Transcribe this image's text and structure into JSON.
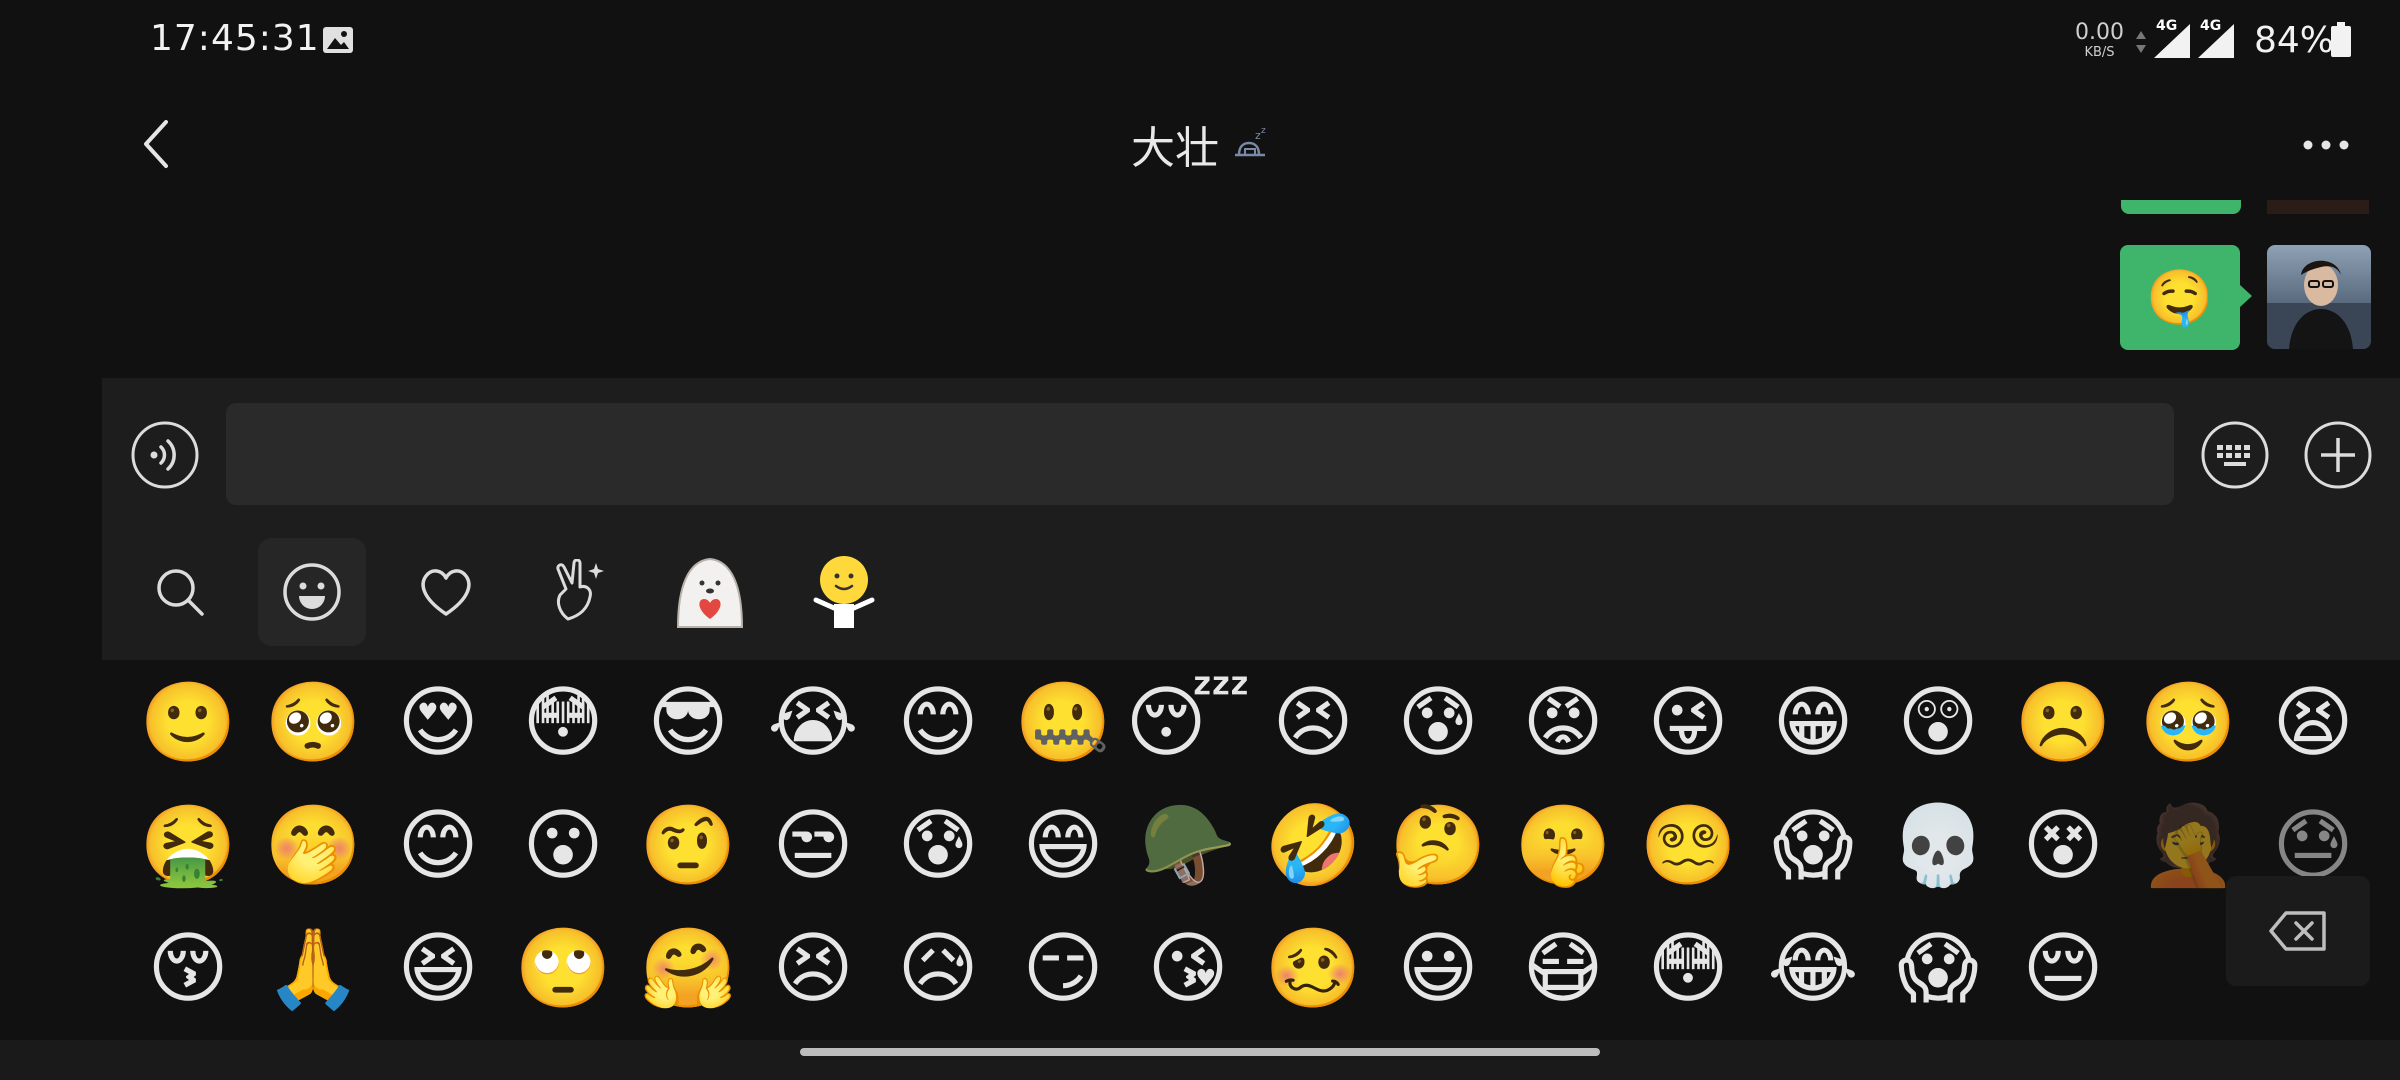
{
  "status_bar": {
    "time": "17:45:31",
    "net_speed_value": "0.00",
    "net_speed_unit": "KB/S",
    "signal_1_label": "4G",
    "signal_2_label": "4G",
    "battery": "84%"
  },
  "header": {
    "title": "大壮",
    "status_icon": "sleep-icon",
    "back_icon": "chevron-left-icon",
    "more_icon": "more-dots-icon"
  },
  "messages": [
    {
      "from": "me",
      "type": "emoji",
      "content": "🤤"
    }
  ],
  "input": {
    "value": "",
    "placeholder": ""
  },
  "emoji_tabs": [
    {
      "name": "search",
      "icon": "search-icon"
    },
    {
      "name": "emoji",
      "icon": "smiley-icon",
      "active": true
    },
    {
      "name": "favorites",
      "icon": "heart-icon"
    },
    {
      "name": "gestures",
      "icon": "hand-sparkle-icon"
    },
    {
      "name": "sticker-pack-1",
      "icon": "seal-heart-sticker-icon"
    },
    {
      "name": "sticker-pack-2",
      "icon": "yellow-figure-sticker-icon"
    }
  ],
  "emoji_rows": [
    [
      "🙂",
      "🥺",
      "😍",
      "😳",
      "😎",
      "😭",
      "😊",
      "🤐",
      "😴",
      "😣",
      "😰",
      "😡",
      "😜",
      "😁",
      "😲",
      "☹️",
      "🥹",
      "😫"
    ],
    [
      "🤮",
      "🤭",
      "😊",
      "😮",
      "🤨",
      "😒",
      "😰",
      "😄",
      "🪖",
      "🤣",
      "🤔",
      "🤫",
      "😵‍💫",
      "😱",
      "💀",
      "😵",
      "🤦",
      "😓"
    ],
    [
      "😚",
      "🙏",
      "😆",
      "🙄",
      "🤗",
      "😣",
      "😥",
      "😏",
      "😘",
      "🥴",
      "😃",
      "😷",
      "😳",
      "😂",
      "😱",
      "😔"
    ]
  ],
  "colors": {
    "background": "#111111",
    "panel": "#1d1d1d",
    "input": "#2a2a2a",
    "bubble": "#3fb56b"
  }
}
